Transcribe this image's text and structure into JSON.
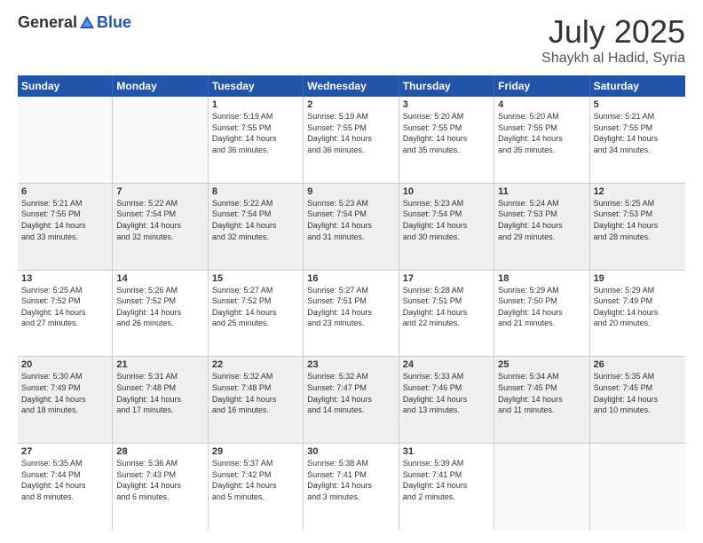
{
  "logo": {
    "general": "General",
    "blue": "Blue"
  },
  "title": "July 2025",
  "location": "Shaykh al Hadid, Syria",
  "days": [
    "Sunday",
    "Monday",
    "Tuesday",
    "Wednesday",
    "Thursday",
    "Friday",
    "Saturday"
  ],
  "rows": [
    [
      {
        "day": "",
        "empty": true
      },
      {
        "day": "",
        "empty": true
      },
      {
        "day": "1",
        "line1": "Sunrise: 5:19 AM",
        "line2": "Sunset: 7:55 PM",
        "line3": "Daylight: 14 hours",
        "line4": "and 36 minutes."
      },
      {
        "day": "2",
        "line1": "Sunrise: 5:19 AM",
        "line2": "Sunset: 7:55 PM",
        "line3": "Daylight: 14 hours",
        "line4": "and 36 minutes."
      },
      {
        "day": "3",
        "line1": "Sunrise: 5:20 AM",
        "line2": "Sunset: 7:55 PM",
        "line3": "Daylight: 14 hours",
        "line4": "and 35 minutes."
      },
      {
        "day": "4",
        "line1": "Sunrise: 5:20 AM",
        "line2": "Sunset: 7:55 PM",
        "line3": "Daylight: 14 hours",
        "line4": "and 35 minutes."
      },
      {
        "day": "5",
        "line1": "Sunrise: 5:21 AM",
        "line2": "Sunset: 7:55 PM",
        "line3": "Daylight: 14 hours",
        "line4": "and 34 minutes."
      }
    ],
    [
      {
        "day": "6",
        "line1": "Sunrise: 5:21 AM",
        "line2": "Sunset: 7:55 PM",
        "line3": "Daylight: 14 hours",
        "line4": "and 33 minutes."
      },
      {
        "day": "7",
        "line1": "Sunrise: 5:22 AM",
        "line2": "Sunset: 7:54 PM",
        "line3": "Daylight: 14 hours",
        "line4": "and 32 minutes."
      },
      {
        "day": "8",
        "line1": "Sunrise: 5:22 AM",
        "line2": "Sunset: 7:54 PM",
        "line3": "Daylight: 14 hours",
        "line4": "and 32 minutes."
      },
      {
        "day": "9",
        "line1": "Sunrise: 5:23 AM",
        "line2": "Sunset: 7:54 PM",
        "line3": "Daylight: 14 hours",
        "line4": "and 31 minutes."
      },
      {
        "day": "10",
        "line1": "Sunrise: 5:23 AM",
        "line2": "Sunset: 7:54 PM",
        "line3": "Daylight: 14 hours",
        "line4": "and 30 minutes."
      },
      {
        "day": "11",
        "line1": "Sunrise: 5:24 AM",
        "line2": "Sunset: 7:53 PM",
        "line3": "Daylight: 14 hours",
        "line4": "and 29 minutes."
      },
      {
        "day": "12",
        "line1": "Sunrise: 5:25 AM",
        "line2": "Sunset: 7:53 PM",
        "line3": "Daylight: 14 hours",
        "line4": "and 28 minutes."
      }
    ],
    [
      {
        "day": "13",
        "line1": "Sunrise: 5:25 AM",
        "line2": "Sunset: 7:52 PM",
        "line3": "Daylight: 14 hours",
        "line4": "and 27 minutes."
      },
      {
        "day": "14",
        "line1": "Sunrise: 5:26 AM",
        "line2": "Sunset: 7:52 PM",
        "line3": "Daylight: 14 hours",
        "line4": "and 26 minutes."
      },
      {
        "day": "15",
        "line1": "Sunrise: 5:27 AM",
        "line2": "Sunset: 7:52 PM",
        "line3": "Daylight: 14 hours",
        "line4": "and 25 minutes."
      },
      {
        "day": "16",
        "line1": "Sunrise: 5:27 AM",
        "line2": "Sunset: 7:51 PM",
        "line3": "Daylight: 14 hours",
        "line4": "and 23 minutes."
      },
      {
        "day": "17",
        "line1": "Sunrise: 5:28 AM",
        "line2": "Sunset: 7:51 PM",
        "line3": "Daylight: 14 hours",
        "line4": "and 22 minutes."
      },
      {
        "day": "18",
        "line1": "Sunrise: 5:29 AM",
        "line2": "Sunset: 7:50 PM",
        "line3": "Daylight: 14 hours",
        "line4": "and 21 minutes."
      },
      {
        "day": "19",
        "line1": "Sunrise: 5:29 AM",
        "line2": "Sunset: 7:49 PM",
        "line3": "Daylight: 14 hours",
        "line4": "and 20 minutes."
      }
    ],
    [
      {
        "day": "20",
        "line1": "Sunrise: 5:30 AM",
        "line2": "Sunset: 7:49 PM",
        "line3": "Daylight: 14 hours",
        "line4": "and 18 minutes."
      },
      {
        "day": "21",
        "line1": "Sunrise: 5:31 AM",
        "line2": "Sunset: 7:48 PM",
        "line3": "Daylight: 14 hours",
        "line4": "and 17 minutes."
      },
      {
        "day": "22",
        "line1": "Sunrise: 5:32 AM",
        "line2": "Sunset: 7:48 PM",
        "line3": "Daylight: 14 hours",
        "line4": "and 16 minutes."
      },
      {
        "day": "23",
        "line1": "Sunrise: 5:32 AM",
        "line2": "Sunset: 7:47 PM",
        "line3": "Daylight: 14 hours",
        "line4": "and 14 minutes."
      },
      {
        "day": "24",
        "line1": "Sunrise: 5:33 AM",
        "line2": "Sunset: 7:46 PM",
        "line3": "Daylight: 14 hours",
        "line4": "and 13 minutes."
      },
      {
        "day": "25",
        "line1": "Sunrise: 5:34 AM",
        "line2": "Sunset: 7:45 PM",
        "line3": "Daylight: 14 hours",
        "line4": "and 11 minutes."
      },
      {
        "day": "26",
        "line1": "Sunrise: 5:35 AM",
        "line2": "Sunset: 7:45 PM",
        "line3": "Daylight: 14 hours",
        "line4": "and 10 minutes."
      }
    ],
    [
      {
        "day": "27",
        "line1": "Sunrise: 5:35 AM",
        "line2": "Sunset: 7:44 PM",
        "line3": "Daylight: 14 hours",
        "line4": "and 8 minutes."
      },
      {
        "day": "28",
        "line1": "Sunrise: 5:36 AM",
        "line2": "Sunset: 7:43 PM",
        "line3": "Daylight: 14 hours",
        "line4": "and 6 minutes."
      },
      {
        "day": "29",
        "line1": "Sunrise: 5:37 AM",
        "line2": "Sunset: 7:42 PM",
        "line3": "Daylight: 14 hours",
        "line4": "and 5 minutes."
      },
      {
        "day": "30",
        "line1": "Sunrise: 5:38 AM",
        "line2": "Sunset: 7:41 PM",
        "line3": "Daylight: 14 hours",
        "line4": "and 3 minutes."
      },
      {
        "day": "31",
        "line1": "Sunrise: 5:39 AM",
        "line2": "Sunset: 7:41 PM",
        "line3": "Daylight: 14 hours",
        "line4": "and 2 minutes."
      },
      {
        "day": "",
        "empty": true
      },
      {
        "day": "",
        "empty": true
      }
    ]
  ]
}
